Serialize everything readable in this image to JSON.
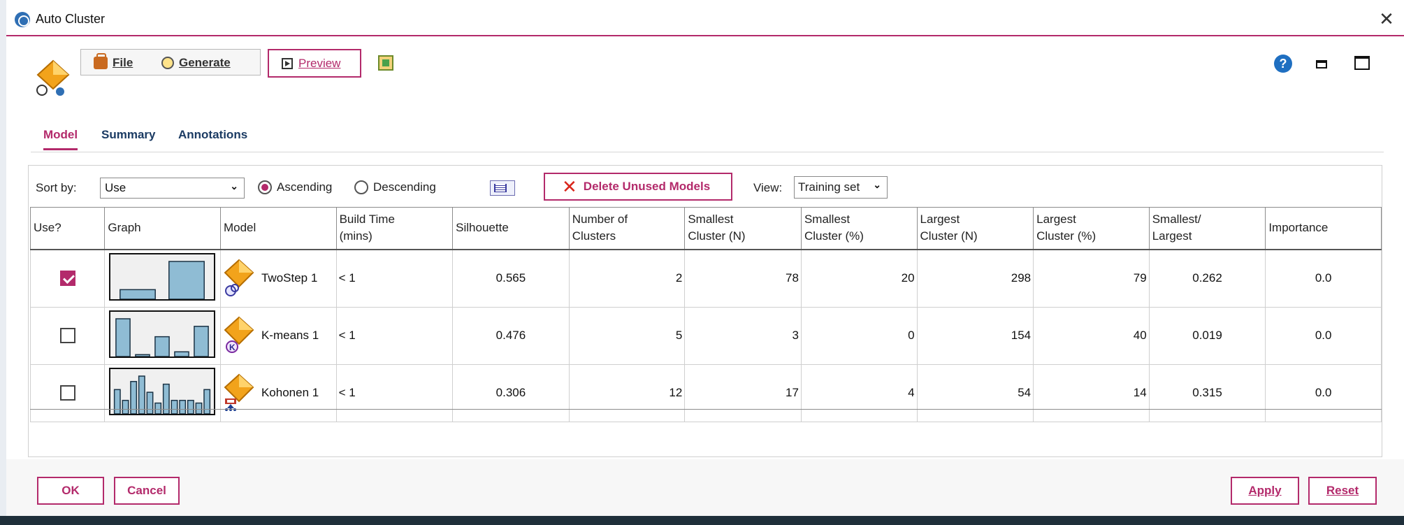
{
  "window": {
    "title": "Auto Cluster"
  },
  "toolbar": {
    "file_label": "File",
    "generate_label": "Generate",
    "preview_label": "Preview"
  },
  "tabs": [
    {
      "label": "Model",
      "active": true
    },
    {
      "label": "Summary",
      "active": false
    },
    {
      "label": "Annotations",
      "active": false
    }
  ],
  "controls": {
    "sort_by_label": "Sort by:",
    "sort_by_value": "Use",
    "ascending_label": "Ascending",
    "descending_label": "Descending",
    "sort_direction": "ascending",
    "delete_label": "Delete Unused Models",
    "view_label": "View:",
    "view_value": "Training set"
  },
  "table": {
    "headers": {
      "use": "Use?",
      "graph": "Graph",
      "model": "Model",
      "build_1": "Build Time",
      "build_2": "(mins)",
      "silhouette": "Silhouette",
      "num_1": "Number of",
      "num_2": "Clusters",
      "sn_1": "Smallest",
      "sn_2": "Cluster (N)",
      "sp_1": "Smallest",
      "sp_2": "Cluster (%)",
      "ln_1": "Largest",
      "ln_2": "Cluster (N)",
      "lp_1": "Largest",
      "lp_2": "Cluster (%)",
      "sl_1": "Smallest/",
      "sl_2": "Largest",
      "importance": "Importance"
    },
    "rows": [
      {
        "use": true,
        "model": "TwoStep 1",
        "icon": "twostep-icon",
        "build": "< 1",
        "silhouette": "0.565",
        "clusters": "2",
        "smallest_n": "78",
        "smallest_pct": "20",
        "largest_n": "298",
        "largest_pct": "79",
        "ratio": "0.262",
        "importance": "0.0",
        "bars": [
          20,
          79
        ]
      },
      {
        "use": false,
        "model": "K-means 1",
        "icon": "kmeans-icon",
        "build": "< 1",
        "silhouette": "0.476",
        "clusters": "5",
        "smallest_n": "3",
        "smallest_pct": "0",
        "largest_n": "154",
        "largest_pct": "40",
        "ratio": "0.019",
        "importance": "0.0",
        "bars": [
          40,
          2,
          21,
          5,
          32
        ]
      },
      {
        "use": false,
        "model": "Kohonen 1",
        "icon": "kohonen-icon",
        "build": "< 1",
        "silhouette": "0.306",
        "clusters": "12",
        "smallest_n": "17",
        "smallest_pct": "4",
        "largest_n": "54",
        "largest_pct": "14",
        "ratio": "0.315",
        "importance": "0.0",
        "bars": [
          9,
          5,
          12,
          14,
          8,
          4,
          11,
          5,
          5,
          5,
          4,
          9
        ]
      }
    ]
  },
  "footer": {
    "ok_label": "OK",
    "cancel_label": "Cancel",
    "apply_label": "Apply",
    "reset_label": "Reset"
  },
  "colors": {
    "accent": "#b32a6b",
    "bar_fill": "#8fbcd4",
    "help": "#1f6fc1"
  }
}
